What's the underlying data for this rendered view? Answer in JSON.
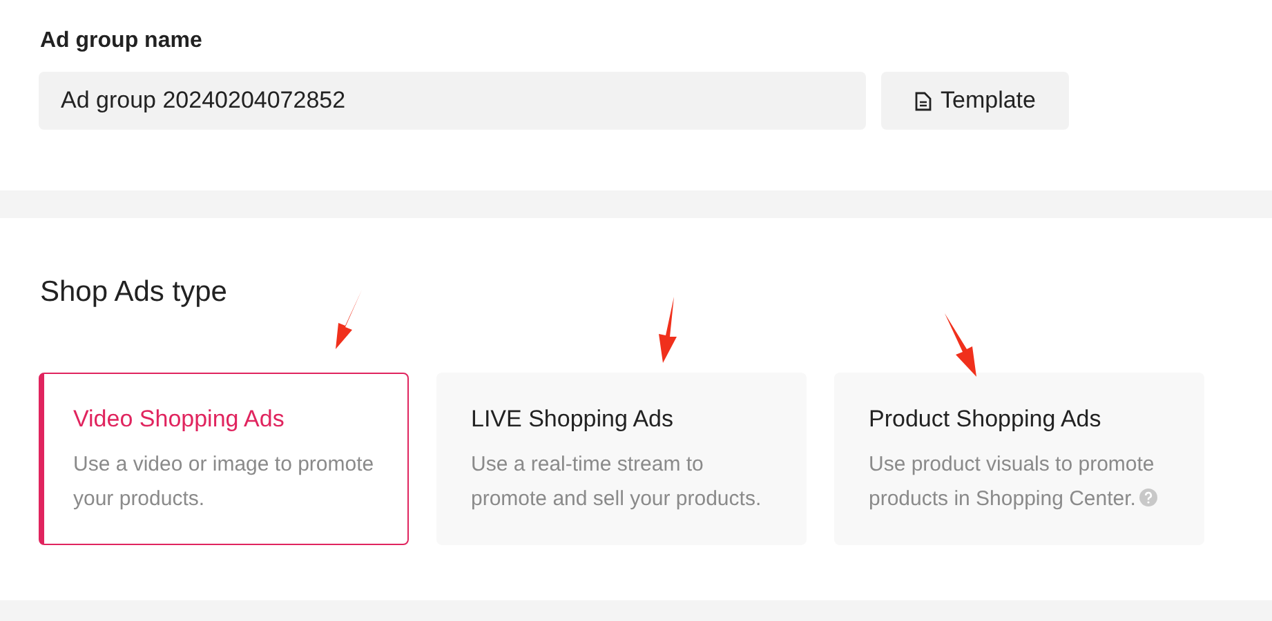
{
  "ad_group": {
    "label": "Ad group name",
    "value": "Ad group 20240204072852",
    "template_button": "Template"
  },
  "shop_ads_type": {
    "title": "Shop Ads type",
    "options": [
      {
        "title": "Video Shopping Ads",
        "description": "Use a video or image to promote your products.",
        "selected": true,
        "help": false
      },
      {
        "title": "LIVE Shopping Ads",
        "description": "Use a real-time stream to promote and sell your products.",
        "selected": false,
        "help": false
      },
      {
        "title": "Product Shopping Ads",
        "description": "Use product visuals to promote products in Shopping Center.",
        "selected": false,
        "help": true
      }
    ]
  }
}
